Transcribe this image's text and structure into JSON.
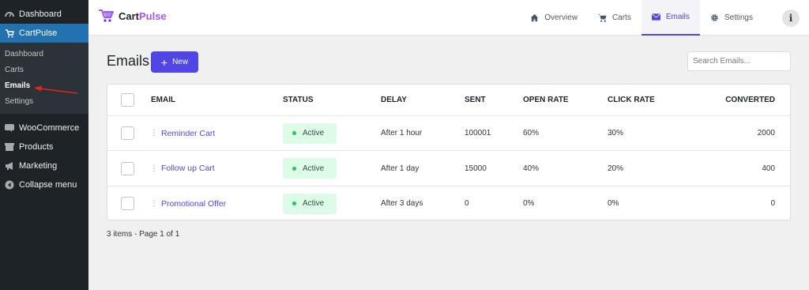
{
  "sidebar": {
    "top_items": [
      {
        "label": "Dashboard",
        "icon": "dashboard-icon"
      },
      {
        "label": "CartPulse",
        "icon": "cartpulse-icon"
      }
    ],
    "submenu": [
      "Dashboard",
      "Carts",
      "Emails",
      "Settings"
    ],
    "bottom_items": [
      {
        "label": "WooCommerce",
        "icon": "woocommerce-icon"
      },
      {
        "label": "Products",
        "icon": "products-icon"
      },
      {
        "label": "Marketing",
        "icon": "megaphone-icon"
      },
      {
        "label": "Collapse menu",
        "icon": "collapse-icon"
      }
    ]
  },
  "brand": {
    "part1": "Cart",
    "part2": "Pulse",
    "accent": "#a855f7"
  },
  "nav": {
    "tabs": [
      {
        "label": "Overview",
        "icon": "home-icon"
      },
      {
        "label": "Carts",
        "icon": "cart-icon"
      },
      {
        "label": "Emails",
        "icon": "envelope-icon"
      },
      {
        "label": "Settings",
        "icon": "gear-icon"
      }
    ],
    "active": "Emails",
    "info_label": "i"
  },
  "page": {
    "title": "Emails",
    "new_button": "New",
    "search_placeholder": "Search Emails...",
    "footer": "3 items - Page 1 of 1"
  },
  "table": {
    "headers": {
      "email": "EMAIL",
      "status": "STATUS",
      "delay": "DELAY",
      "sent": "SENT",
      "open_rate": "OPEN RATE",
      "click_rate": "CLICK RATE",
      "converted": "CONVERTED"
    },
    "rows": [
      {
        "email": "Reminder Cart",
        "status": "Active",
        "delay": "After 1 hour",
        "sent": "100001",
        "open_rate": "60%",
        "click_rate": "30%",
        "converted": "2000"
      },
      {
        "email": "Follow up Cart",
        "status": "Active",
        "delay": "After 1 day",
        "sent": "15000",
        "open_rate": "40%",
        "click_rate": "20%",
        "converted": "400"
      },
      {
        "email": "Promotional Offer",
        "status": "Active",
        "delay": "After 3 days",
        "sent": "0",
        "open_rate": "0%",
        "click_rate": "0%",
        "converted": "0"
      }
    ]
  },
  "colors": {
    "primary": "#4f46e5",
    "wp_active": "#2271b1",
    "active_badge": "#dcfce7",
    "annotation_arrow": "#e02424"
  }
}
